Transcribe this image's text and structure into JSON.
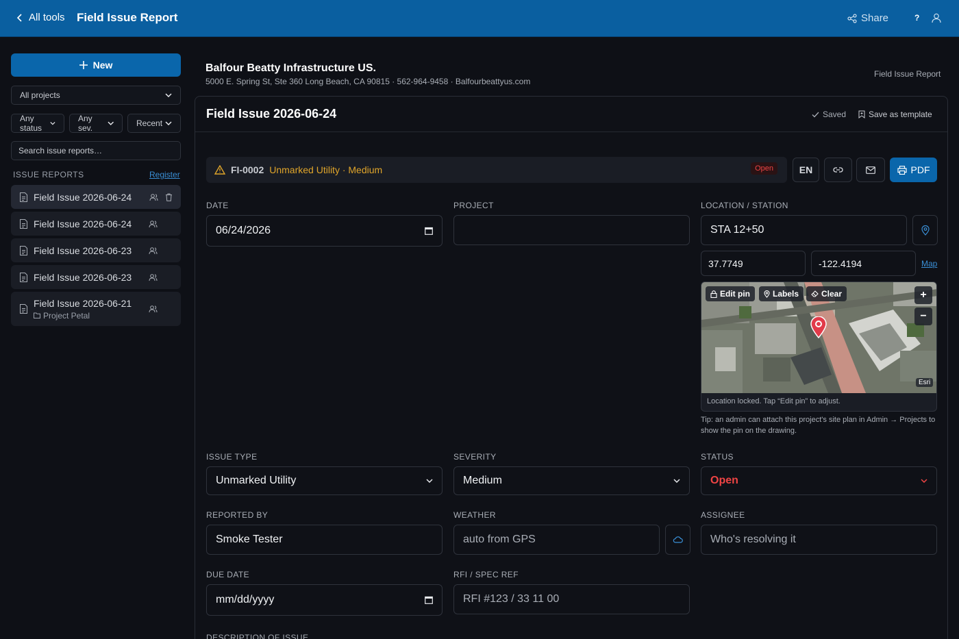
{
  "topbar": {
    "back_label": "All tools",
    "title": "Field Issue Report",
    "share_label": "Share",
    "help_label": "?"
  },
  "sidebar": {
    "new_label": "New",
    "project_filter": "All projects",
    "status_filter": "Any status",
    "severity_filter": "Any sev.",
    "sort_filter": "Recent",
    "search_placeholder": "Search issue reports…",
    "section_title": "ISSUE REPORTS",
    "register_label": "Register",
    "reports": [
      {
        "name": "Field Issue 2026-06-24",
        "sub": ""
      },
      {
        "name": "Field Issue 2026-06-24",
        "sub": ""
      },
      {
        "name": "Field Issue 2026-06-23",
        "sub": ""
      },
      {
        "name": "Field Issue 2026-06-23",
        "sub": ""
      },
      {
        "name": "Field Issue 2026-06-21",
        "sub": "Project Petal"
      }
    ]
  },
  "header": {
    "company": "Balfour Beatty Infrastructure US.",
    "address": "5000 E. Spring St, Ste 360 Long Beach, CA 90815 · 562-964-9458 · Balfourbeattyus.com",
    "doc_type": "Field Issue Report"
  },
  "card": {
    "title": "Field Issue 2026-06-24",
    "saved_label": "Saved",
    "template_label": "Save as template"
  },
  "issue": {
    "code": "FI-0002",
    "summary": "Unmarked Utility · Medium",
    "status_badge": "Open",
    "lang_label": "EN",
    "pdf_label": "PDF"
  },
  "form": {
    "date_label": "DATE",
    "date_value": "06/24/2026",
    "project_label": "PROJECT",
    "project_value": "",
    "location_label": "LOCATION / STATION",
    "location_value": "STA 12+50",
    "lat": "37.7749",
    "lng": "-122.4194",
    "map_link": "Map",
    "issue_type_label": "ISSUE TYPE",
    "issue_type_value": "Unmarked Utility",
    "severity_label": "SEVERITY",
    "severity_value": "Medium",
    "status_label": "STATUS",
    "status_value": "Open",
    "reported_by_label": "REPORTED BY",
    "reported_by_value": "Smoke Tester",
    "weather_label": "WEATHER",
    "weather_placeholder": "auto from GPS",
    "assignee_label": "ASSIGNEE",
    "assignee_placeholder": "Who's resolving it",
    "due_date_label": "DUE DATE",
    "due_date_placeholder": "mm/dd/yyyy",
    "rfi_label": "RFI / SPEC REF",
    "rfi_placeholder": "RFI #123 / 33 11 00",
    "description_label": "DESCRIPTION OF ISSUE"
  },
  "map": {
    "edit_pin_label": "Edit pin",
    "labels_label": "Labels",
    "clear_label": "Clear",
    "zoom_in": "+",
    "zoom_out": "−",
    "attribution": "Esri",
    "caption": "Location locked. Tap “Edit pin” to adjust.",
    "tip": "Tip: an admin can attach this project's site plan in Admin → Projects to show the pin on the drawing."
  },
  "colors": {
    "topbar": "#0a5fa0",
    "accent": "#0a66ab",
    "warning": "#e0a52a",
    "danger": "#ef4444"
  }
}
